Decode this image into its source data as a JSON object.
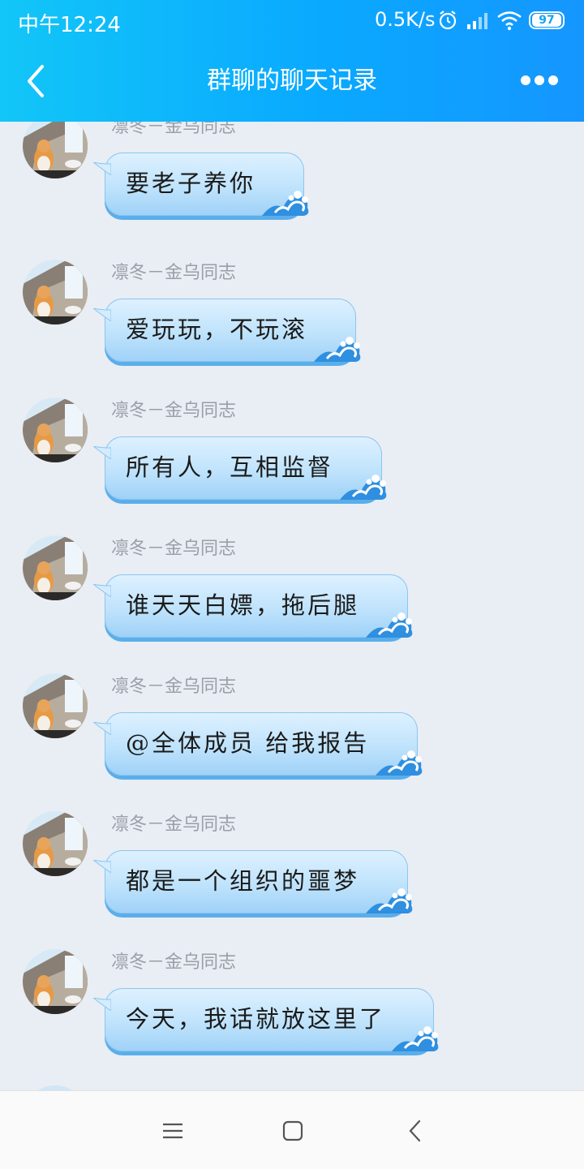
{
  "status": {
    "time": "中午12:24",
    "speed": "0.5K/s",
    "battery": "97",
    "icons": [
      "alarm-icon",
      "signal-icon",
      "wifi-icon",
      "battery-icon"
    ]
  },
  "header": {
    "title": "群聊的聊天记录",
    "back_icon": "back-arrow-icon",
    "more_icon": "more-dots-icon"
  },
  "messages": [
    {
      "sender": "凛冬－金乌同志",
      "text": "要老子养你"
    },
    {
      "sender": "凛冬－金乌同志",
      "text": "爱玩玩，不玩滚"
    },
    {
      "sender": "凛冬－金乌同志",
      "text": "所有人，互相监督"
    },
    {
      "sender": "凛冬－金乌同志",
      "text": "谁天天白嫖，拖后腿"
    },
    {
      "sender": "凛冬－金乌同志",
      "text": "@全体成员 给我报告"
    },
    {
      "sender": "凛冬－金乌同志",
      "text": "都是一个组织的噩梦"
    },
    {
      "sender": "凛冬－金乌同志",
      "text": "今天，我话就放这里了"
    }
  ],
  "navbar": {
    "icons": [
      "menu-icon",
      "home-square-icon",
      "back-chevron-icon"
    ]
  },
  "colors": {
    "header_start": "#12c6f7",
    "header_end": "#1596ff",
    "background": "#e9edf4",
    "bubble": "#bfe3fc",
    "sender_text": "#9a9ea6"
  }
}
